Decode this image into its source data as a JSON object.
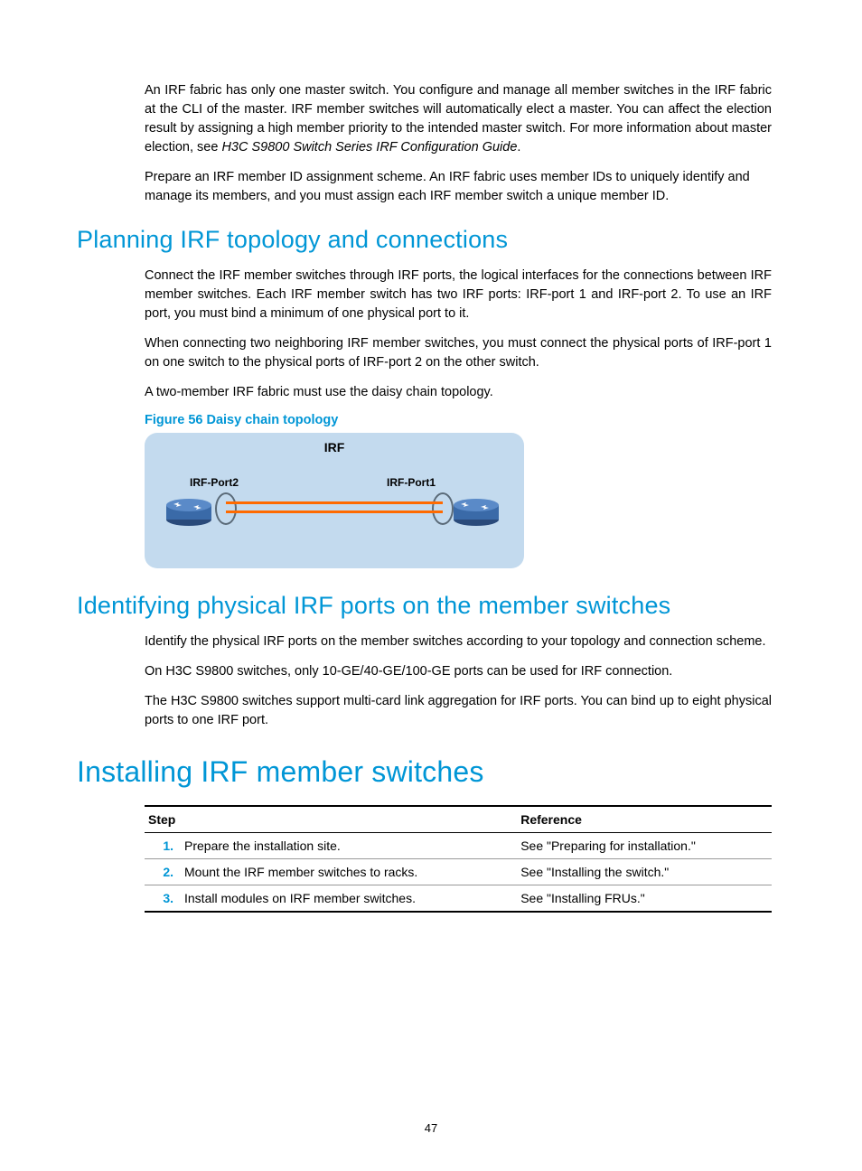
{
  "intro": {
    "p1a": "An IRF fabric has only one master switch. You configure and manage all member switches in the IRF fabric at the CLI of the master. IRF member switches will automatically elect a master. You can affect the election result by assigning a high member priority to the intended master switch. For more information about master election, see ",
    "p1b": "H3C S9800 Switch Series IRF Configuration Guide",
    "p1c": ".",
    "p2": "Prepare an IRF member ID assignment scheme. An IRF fabric uses member IDs to uniquely identify and manage its members, and you must assign each IRF member switch a unique member ID."
  },
  "section1": {
    "heading": "Planning IRF topology and connections",
    "p1": "Connect the IRF member switches through IRF ports, the logical interfaces for the connections between IRF member switches. Each IRF member switch has two IRF ports: IRF-port 1 and IRF-port 2. To use an IRF port, you must bind a minimum of one physical port to it.",
    "p2": "When connecting two neighboring IRF member switches, you must connect the physical ports of IRF-port 1 on one switch to the physical ports of IRF-port 2 on the other switch.",
    "p3": "A two-member IRF fabric must use the daisy chain topology.",
    "figure_caption": "Figure 56 Daisy chain topology",
    "figure": {
      "title": "IRF",
      "port_left": "IRF-Port2",
      "port_right": "IRF-Port1"
    }
  },
  "section2": {
    "heading": "Identifying physical IRF ports on the member switches",
    "p1": "Identify the physical IRF ports on the member switches according to your topology and connection scheme.",
    "p2": "On H3C S9800 switches, only 10-GE/40-GE/100-GE ports can be used for IRF connection.",
    "p3": "The H3C S9800 switches support multi-card link aggregation for IRF ports. You can bind up to eight physical ports to one IRF port."
  },
  "section3": {
    "heading": "Installing IRF member switches",
    "table": {
      "head_step": "Step",
      "head_ref": "Reference",
      "rows": [
        {
          "num": "1.",
          "step": "Prepare the installation site.",
          "ref": "See \"Preparing for installation.\""
        },
        {
          "num": "2.",
          "step": "Mount the IRF member switches to racks.",
          "ref": "See \"Installing the switch.\""
        },
        {
          "num": "3.",
          "step": "Install modules on IRF member switches.",
          "ref": "See  \"Installing FRUs.\""
        }
      ]
    }
  },
  "page_number": "47"
}
